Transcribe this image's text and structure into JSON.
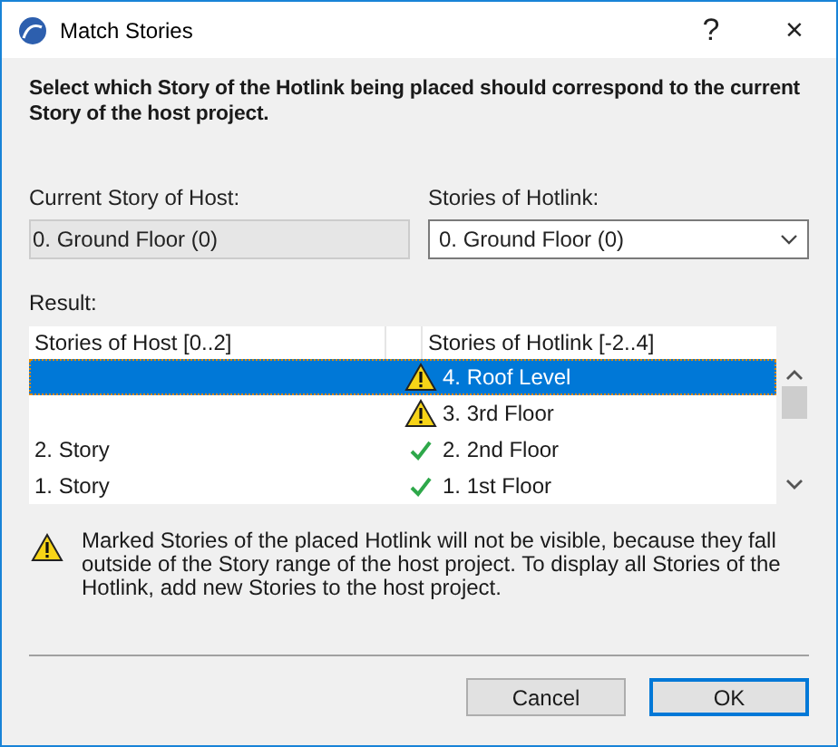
{
  "window": {
    "title": "Match Stories",
    "help": "?",
    "close": "×"
  },
  "instruction": "Select which Story of the Hotlink being placed should correspond to the current Story of the host project.",
  "current_story": {
    "label": "Current Story of Host:",
    "value": "0. Ground Floor (0)"
  },
  "hotlink_story": {
    "label": "Stories of Hotlink:",
    "value": "0. Ground Floor (0)"
  },
  "result": {
    "label": "Result:",
    "columns": [
      "Stories of Host [0..2]",
      "Stories of Hotlink [-2..4]"
    ],
    "rows": [
      {
        "host": "",
        "kind": "warning",
        "hotlink": "4. Roof Level",
        "selected": true
      },
      {
        "host": "",
        "kind": "warning",
        "hotlink": "3. 3rd Floor",
        "selected": false
      },
      {
        "host": "2. Story",
        "kind": "ok",
        "hotlink": "2. 2nd Floor",
        "selected": false
      },
      {
        "host": "1. Story",
        "kind": "ok",
        "hotlink": "1. 1st Floor",
        "selected": false
      }
    ]
  },
  "warning": "Marked Stories of the placed Hotlink will not be visible, because they fall outside of the Story range of the host project. To display all Stories of the Hotlink, add new Stories to the host project.",
  "buttons": [
    {
      "label": "Cancel",
      "default": false
    },
    {
      "label": "OK",
      "default": true
    }
  ]
}
